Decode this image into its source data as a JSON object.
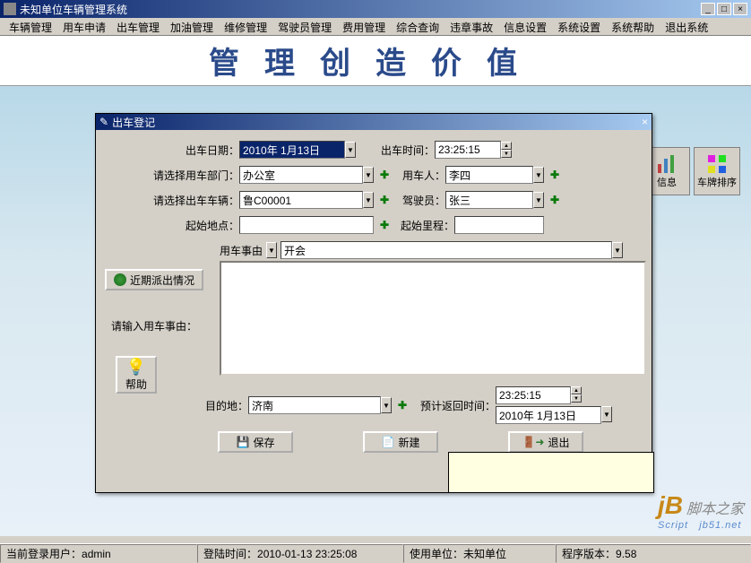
{
  "window": {
    "title": "未知单位车辆管理系统",
    "min": "_",
    "max": "□",
    "close": "×"
  },
  "menu": [
    "车辆管理",
    "用车申请",
    "出车管理",
    "加油管理",
    "维修管理",
    "驾驶员管理",
    "费用管理",
    "综合查询",
    "违章事故",
    "信息设置",
    "系统设置",
    "系统帮助",
    "退出系统"
  ],
  "banner": "管理创造价值",
  "toolbar": {
    "info": "信息",
    "sort": "车牌排序"
  },
  "dialog": {
    "title": "出车登记",
    "close": "×",
    "labels": {
      "date": "出车日期：",
      "time": "出车时间：",
      "dept": "请选择用车部门：",
      "user": "用车人：",
      "vehicle": "请选择出车车辆：",
      "driver": "驾驶员：",
      "start_loc": "起始地点：",
      "start_mile": "起始里程：",
      "reason_hdr": "用车事由",
      "reason_desc": "请输入用车事由：",
      "dest": "目的地：",
      "return_time": "预计返回时间："
    },
    "values": {
      "date": "2010年 1月13日",
      "time": "23:25:15",
      "dept": "办公室",
      "user": "李四",
      "vehicle": "鲁C00001",
      "driver": "张三",
      "start_loc": "",
      "start_mile": "",
      "reason": "开会",
      "dest": "济南",
      "return_time": "23:25:15",
      "return_date": "2010年 1月13日"
    },
    "buttons": {
      "recent": "近期派出情况",
      "help": "帮助",
      "save": "保存",
      "new": "新建",
      "exit": "退出"
    }
  },
  "status": {
    "user_label": "当前登录用户：",
    "user": "admin",
    "login_label": "登陆时间：",
    "login_time": "2010-01-13 23:25:08",
    "unit_label": "使用单位：",
    "unit": "未知单位",
    "version_label": "程序版本：",
    "version": "9.58"
  },
  "watermark": {
    "brand": "脚本之家",
    "url": "jb51.net",
    "script": "Script"
  }
}
